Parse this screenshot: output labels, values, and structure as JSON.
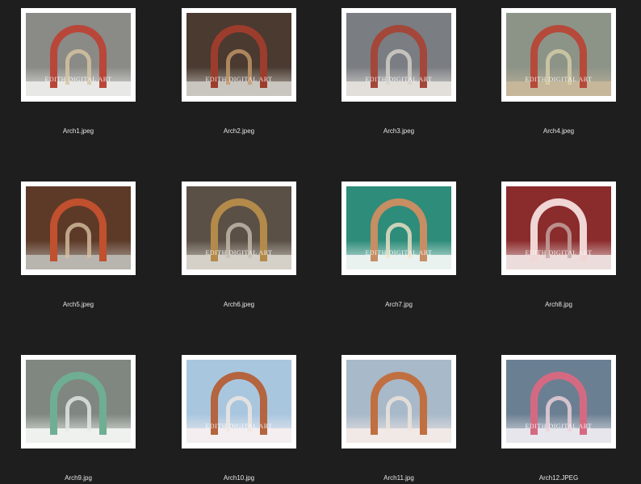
{
  "watermark_text": "EDITH DIGITAL ART",
  "files": [
    {
      "name": "Arch1.jpeg",
      "watermark": true,
      "sky": "#8a8a86",
      "arch": "#b8473a",
      "inner": "#d9c7a2",
      "ground": "#e8e8e6"
    },
    {
      "name": "Arch2.jpeg",
      "watermark": true,
      "sky": "#4a3a30",
      "arch": "#9c3c2c",
      "inner": "#c79a6a",
      "ground": "#c9c6c0"
    },
    {
      "name": "Arch3.jpeg",
      "watermark": true,
      "sky": "#7a7d82",
      "arch": "#a3473a",
      "inner": "#d8d4cc",
      "ground": "#e2dfdb"
    },
    {
      "name": "Arch4.jpeg",
      "watermark": true,
      "sky": "#8c9488",
      "arch": "#b54a3b",
      "inner": "#d9cfa9",
      "ground": "#c6b79a"
    },
    {
      "name": "Arch5.jpeg",
      "watermark": false,
      "sky": "#5d3a28",
      "arch": "#c0502e",
      "inner": "#d7c0a0",
      "ground": "#b8b4ae"
    },
    {
      "name": "Arch6.jpeg",
      "watermark": true,
      "sky": "#5a5046",
      "arch": "#b48a4a",
      "inner": "#c9bfae",
      "ground": "#d5d0c8"
    },
    {
      "name": "Arch7.jpg",
      "watermark": true,
      "sky": "#2d8c7a",
      "arch": "#c78d63",
      "inner": "#f3e4c8",
      "ground": "#e9f2ef"
    },
    {
      "name": "Arch8.jpg",
      "watermark": true,
      "sky": "#8a2b2c",
      "arch": "#f0d6d4",
      "inner": "#c7a8a4",
      "ground": "#eddcdc"
    },
    {
      "name": "Arch9.jpg",
      "watermark": false,
      "sky": "#7f8780",
      "arch": "#6fae92",
      "inner": "#e7ece8",
      "ground": "#eef1ee"
    },
    {
      "name": "Arch10.jpg",
      "watermark": true,
      "sky": "#a9c6df",
      "arch": "#b4643e",
      "inner": "#f2e9e2",
      "ground": "#f4eef0"
    },
    {
      "name": "Arch11.jpg",
      "watermark": false,
      "sky": "#a8b9c9",
      "arch": "#c06f40",
      "inner": "#f1e6dc",
      "ground": "#f1e9e6"
    },
    {
      "name": "Arch12.JPEG",
      "watermark": true,
      "sky": "#6b7f92",
      "arch": "#d46a82",
      "inner": "#f0d4dc",
      "ground": "#e6e6ec"
    }
  ]
}
